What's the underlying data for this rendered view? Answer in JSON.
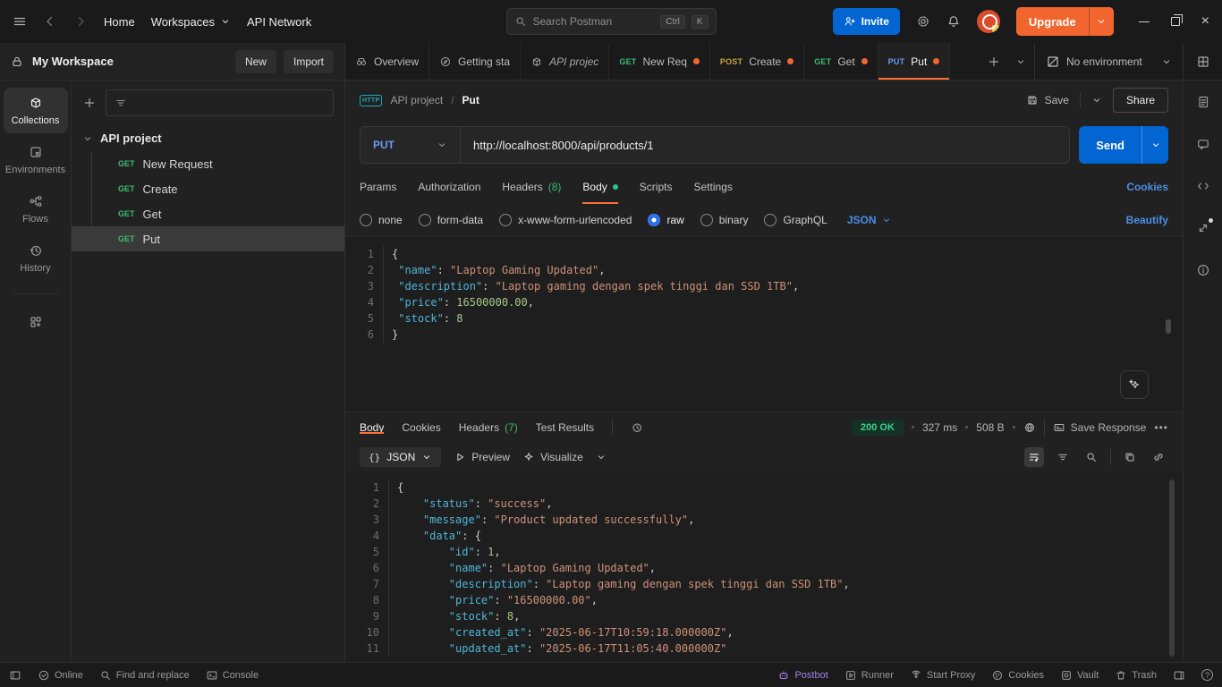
{
  "topbar": {
    "home": "Home",
    "workspaces": "Workspaces",
    "api_network": "API Network",
    "search_placeholder": "Search Postman",
    "shortcut_ctrl": "Ctrl",
    "shortcut_k": "K",
    "invite_label": "Invite",
    "upgrade_label": "Upgrade"
  },
  "workspace_bar": {
    "workspace_name": "My Workspace",
    "new_label": "New",
    "import_label": "Import"
  },
  "tabs": {
    "items": [
      {
        "icon": "overview",
        "label": "Overview"
      },
      {
        "icon": "getting-started",
        "label": "Getting sta"
      },
      {
        "icon": "collection",
        "label": "API projec",
        "italic": true
      },
      {
        "method": "GET",
        "label": "New Req",
        "dirty": true
      },
      {
        "method": "POST",
        "label": "Create",
        "dirty": true
      },
      {
        "method": "GET",
        "label": "Get",
        "dirty": true
      },
      {
        "method": "PUT",
        "label": "Put",
        "dirty": true,
        "active": true
      }
    ],
    "environment": "No environment"
  },
  "sidebar": {
    "rail": [
      {
        "id": "collections",
        "label": "Collections",
        "active": true
      },
      {
        "id": "environments",
        "label": "Environments"
      },
      {
        "id": "flows",
        "label": "Flows"
      },
      {
        "id": "history",
        "label": "History"
      }
    ],
    "collection_name": "API project",
    "items": [
      {
        "method": "GET",
        "name": "New Request"
      },
      {
        "method": "GET",
        "name": "Create"
      },
      {
        "method": "GET",
        "name": "Get"
      },
      {
        "method": "GET",
        "name": "Put",
        "selected": true
      }
    ]
  },
  "request": {
    "breadcrumb_collection": "API project",
    "breadcrumb_separator": "/",
    "breadcrumb_name": "Put",
    "save_label": "Save",
    "share_label": "Share",
    "method": "PUT",
    "url": "http://localhost:8000/api/products/1",
    "send_label": "Send",
    "tabs": [
      {
        "label": "Params"
      },
      {
        "label": "Authorization"
      },
      {
        "label": "Headers",
        "count": "(8)"
      },
      {
        "label": "Body",
        "active": true,
        "dot": true
      },
      {
        "label": "Scripts"
      },
      {
        "label": "Settings"
      }
    ],
    "cookies_link": "Cookies",
    "body_modes": [
      "none",
      "form-data",
      "x-www-form-urlencoded",
      "raw",
      "binary",
      "GraphQL"
    ],
    "selected_mode": "raw",
    "language": "JSON",
    "beautify_link": "Beautify",
    "editor_lines": [
      [
        [
          "p",
          "{"
        ]
      ],
      [
        [
          "p",
          " "
        ],
        [
          "k",
          "\"name\""
        ],
        [
          "p",
          ": "
        ],
        [
          "s",
          "\"Laptop Gaming Updated\""
        ],
        [
          "p",
          ","
        ]
      ],
      [
        [
          "p",
          " "
        ],
        [
          "k",
          "\"description\""
        ],
        [
          "p",
          ": "
        ],
        [
          "s",
          "\"Laptop gaming dengan spek tinggi dan SSD 1TB\""
        ],
        [
          "p",
          ","
        ]
      ],
      [
        [
          "p",
          " "
        ],
        [
          "k",
          "\"price\""
        ],
        [
          "p",
          ": "
        ],
        [
          "n",
          "16500000.00"
        ],
        [
          "p",
          ","
        ]
      ],
      [
        [
          "p",
          " "
        ],
        [
          "k",
          "\"stock\""
        ],
        [
          "p",
          ": "
        ],
        [
          "n",
          "8"
        ]
      ],
      [
        [
          "p",
          "}"
        ]
      ]
    ]
  },
  "response": {
    "tabs": [
      {
        "label": "Body",
        "active": true
      },
      {
        "label": "Cookies"
      },
      {
        "label": "Headers",
        "count": "(7)"
      },
      {
        "label": "Test Results"
      }
    ],
    "status": "200 OK",
    "time": "327 ms",
    "size": "508 B",
    "save_label": "Save Response",
    "more_label": "•••",
    "format": "JSON",
    "format_braces": "{}",
    "preview_label": "Preview",
    "visualize_label": "Visualize",
    "editor_lines": [
      [
        [
          "p",
          "{"
        ]
      ],
      [
        [
          "p",
          "    "
        ],
        [
          "k",
          "\"status\""
        ],
        [
          "p",
          ": "
        ],
        [
          "s",
          "\"success\""
        ],
        [
          "p",
          ","
        ]
      ],
      [
        [
          "p",
          "    "
        ],
        [
          "k",
          "\"message\""
        ],
        [
          "p",
          ": "
        ],
        [
          "s",
          "\"Product updated successfully\""
        ],
        [
          "p",
          ","
        ]
      ],
      [
        [
          "p",
          "    "
        ],
        [
          "k",
          "\"data\""
        ],
        [
          "p",
          ": {"
        ]
      ],
      [
        [
          "p",
          "        "
        ],
        [
          "k",
          "\"id\""
        ],
        [
          "p",
          ": "
        ],
        [
          "n",
          "1"
        ],
        [
          "p",
          ","
        ]
      ],
      [
        [
          "p",
          "        "
        ],
        [
          "k",
          "\"name\""
        ],
        [
          "p",
          ": "
        ],
        [
          "s",
          "\"Laptop Gaming Updated\""
        ],
        [
          "p",
          ","
        ]
      ],
      [
        [
          "p",
          "        "
        ],
        [
          "k",
          "\"description\""
        ],
        [
          "p",
          ": "
        ],
        [
          "s",
          "\"Laptop gaming dengan spek tinggi dan SSD 1TB\""
        ],
        [
          "p",
          ","
        ]
      ],
      [
        [
          "p",
          "        "
        ],
        [
          "k",
          "\"price\""
        ],
        [
          "p",
          ": "
        ],
        [
          "s",
          "\"16500000.00\""
        ],
        [
          "p",
          ","
        ]
      ],
      [
        [
          "p",
          "        "
        ],
        [
          "k",
          "\"stock\""
        ],
        [
          "p",
          ": "
        ],
        [
          "n",
          "8"
        ],
        [
          "p",
          ","
        ]
      ],
      [
        [
          "p",
          "        "
        ],
        [
          "k",
          "\"created_at\""
        ],
        [
          "p",
          ": "
        ],
        [
          "s",
          "\"2025-06-17T10:59:18.000000Z\""
        ],
        [
          "p",
          ","
        ]
      ],
      [
        [
          "p",
          "        "
        ],
        [
          "k",
          "\"updated_at\""
        ],
        [
          "p",
          ": "
        ],
        [
          "s",
          "\"2025-06-17T11:05:40.000000Z\""
        ]
      ]
    ]
  },
  "statusbar": {
    "online": "Online",
    "find": "Find and replace",
    "console": "Console",
    "postbot": "Postbot",
    "runner": "Runner",
    "start_proxy": "Start Proxy",
    "cookies": "Cookies",
    "vault": "Vault",
    "trash": "Trash"
  },
  "colors": {
    "accent_orange": "#ff6c37",
    "button_blue": "#0265d2",
    "link_blue": "#4a8fe7",
    "method_get": "#3dba74",
    "method_post": "#c9a13d",
    "method_put": "#6a9bf5",
    "success_green": "#3ecf8e"
  }
}
